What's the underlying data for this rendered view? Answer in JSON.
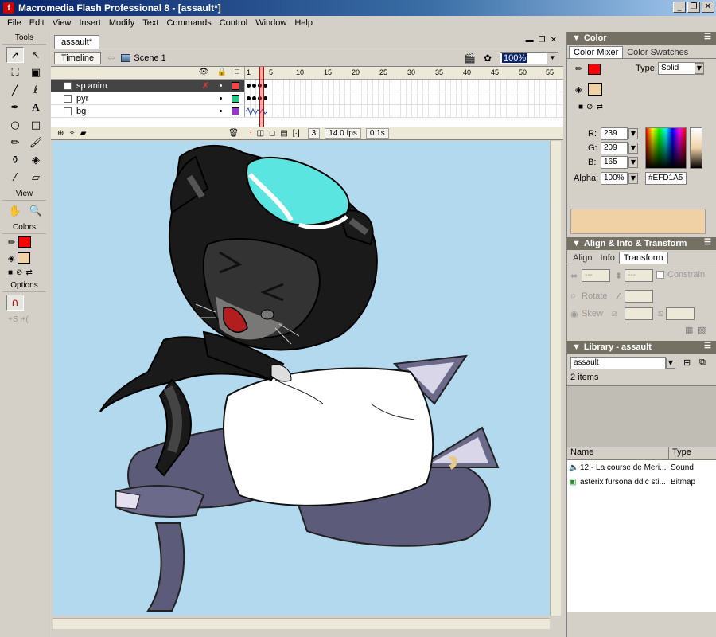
{
  "window": {
    "title": "Macromedia Flash Professional 8 - [assault*]",
    "buttons": [
      "_",
      "❐",
      "✕"
    ]
  },
  "menu": [
    "File",
    "Edit",
    "View",
    "Insert",
    "Modify",
    "Text",
    "Commands",
    "Control",
    "Window",
    "Help"
  ],
  "tools": {
    "title": "Tools",
    "view_title": "View",
    "colors_title": "Colors",
    "options_title": "Options",
    "stroke_color": "#ff0000",
    "fill_color": "#efd1a5"
  },
  "document": {
    "tab": "assault*",
    "timeline_button": "Timeline",
    "scene": "Scene 1",
    "zoom": "100%"
  },
  "timeline": {
    "ruler": [
      "1",
      "5",
      "10",
      "15",
      "20",
      "25",
      "30",
      "35",
      "40",
      "45",
      "50",
      "55"
    ],
    "layers": [
      {
        "name": "sp anim",
        "color": "#ff4040",
        "selected": true
      },
      {
        "name": "pyr",
        "color": "#22cc88",
        "selected": false
      },
      {
        "name": "bg",
        "color": "#9933cc",
        "selected": false
      }
    ],
    "current_frame": "3",
    "fps": "14.0 fps",
    "time": "0.1s"
  },
  "color_panel": {
    "title": "Color",
    "tabs": [
      "Color Mixer",
      "Color Swatches"
    ],
    "type_label": "Type:",
    "type_value": "Solid",
    "r_label": "R:",
    "r": "239",
    "g_label": "G:",
    "g": "209",
    "b_label": "B:",
    "b": "165",
    "alpha_label": "Alpha:",
    "alpha": "100%",
    "hex": "#EFD1A5",
    "preview": "#efd1a5"
  },
  "align_panel": {
    "title": "Align & Info & Transform",
    "tabs": [
      "Align",
      "Info",
      "Transform"
    ],
    "w": "---",
    "h": "---",
    "constrain": "Constrain",
    "rotate": "Rotate",
    "rotate_value": "",
    "skew": "Skew"
  },
  "library": {
    "title": "Library - assault",
    "doc": "assault",
    "count": "2 items",
    "col_name": "Name",
    "col_type": "Type",
    "items": [
      {
        "name": "12 - La course de Meri...",
        "type": "Sound",
        "icon": "sound-icon"
      },
      {
        "name": "asterix fursona ddlc sti...",
        "type": "Bitmap",
        "icon": "bitmap-icon"
      }
    ]
  }
}
